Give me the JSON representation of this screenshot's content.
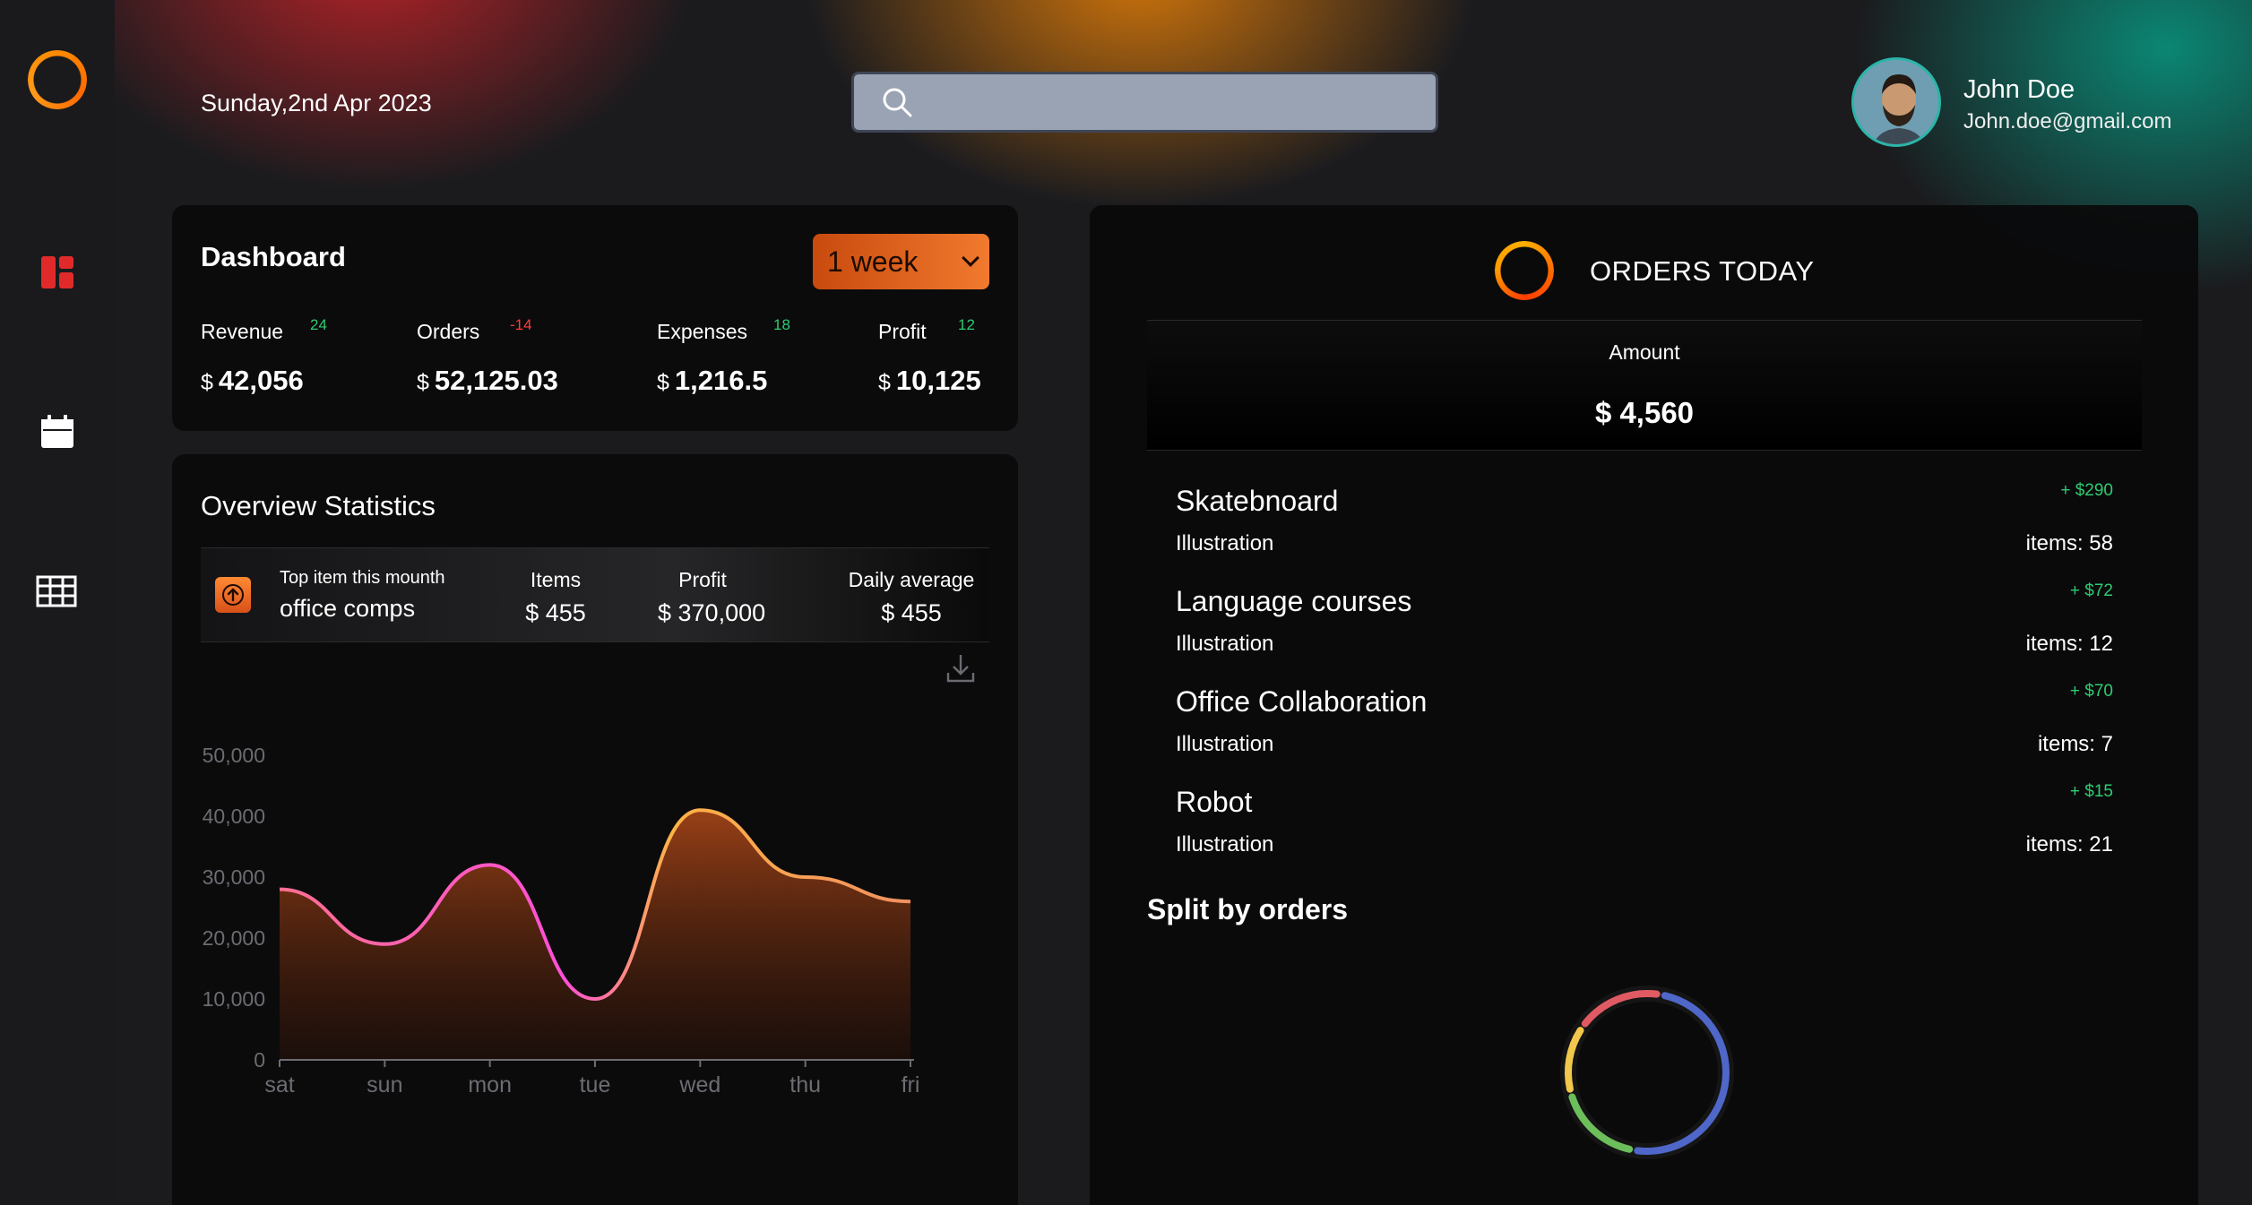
{
  "header": {
    "date": "Sunday,2nd Apr 2023",
    "search": {
      "placeholder": "",
      "value": ""
    },
    "user": {
      "name": "John Doe",
      "email": "John.doe@gmail.com"
    }
  },
  "sidebar": {
    "items": [
      {
        "icon": "logo-ring-icon"
      },
      {
        "icon": "dashboard-icon",
        "active": true,
        "color": "#e02a2a"
      },
      {
        "icon": "calendar-icon"
      },
      {
        "icon": "table-icon"
      }
    ]
  },
  "dashboard": {
    "title": "Dashboard",
    "period": "1 week",
    "stats": [
      {
        "label": "Revenue",
        "delta": "24",
        "currency": "$",
        "value": "42,056"
      },
      {
        "label": "Orders",
        "delta": "-14",
        "currency": "$",
        "value": "52,125.03"
      },
      {
        "label": "Expenses",
        "delta": "18",
        "currency": "$",
        "value": "1,216.5"
      },
      {
        "label": "Profit",
        "delta": "12",
        "currency": "$",
        "value": "10,125"
      }
    ]
  },
  "overview": {
    "title": "Overview Statistics",
    "top_item_label": "Top item this mounth",
    "top_item_value": "office comps",
    "columns": [
      {
        "header": "Items",
        "value": "$ 455"
      },
      {
        "header": "Profit",
        "value": "$ 370,000"
      },
      {
        "header": "Daily average",
        "value": "$ 455"
      }
    ]
  },
  "chart_data": {
    "type": "area",
    "categories": [
      "sat",
      "sun",
      "mon",
      "tue",
      "wed",
      "thu",
      "fri"
    ],
    "values": [
      28000,
      19000,
      32000,
      10000,
      41000,
      30000,
      26000
    ],
    "yticks": [
      "0",
      "10,000",
      "20,000",
      "30,000",
      "40,000",
      "50,000"
    ],
    "ylim": [
      0,
      50000
    ],
    "grid": false,
    "colors": [
      "#ff6f91",
      "#ff4fd8",
      "#ffb347"
    ]
  },
  "orders": {
    "title": "ORDERS TODAY",
    "amount_label": "Amount",
    "amount_value": "$ 4,560",
    "items": [
      {
        "name": "Skatebnoard",
        "delta": "+ $290",
        "sub": "Illustration",
        "count": "items: 58"
      },
      {
        "name": "Language courses",
        "delta": "+ $72",
        "sub": "Illustration",
        "count": "items: 12"
      },
      {
        "name": "Office Collaboration",
        "delta": "+ $70",
        "sub": "Illustration",
        "count": "items: 7"
      },
      {
        "name": "Robot",
        "delta": "+ $15",
        "sub": "Illustration",
        "count": "items: 21"
      }
    ],
    "split_title": "Split by orders",
    "split_segments": [
      {
        "color": "#4f67c9",
        "value": 50
      },
      {
        "color": "#6cbf5a",
        "value": 18
      },
      {
        "color": "#f1c84b",
        "value": 14
      },
      {
        "color": "#e05a63",
        "value": 18
      }
    ]
  }
}
